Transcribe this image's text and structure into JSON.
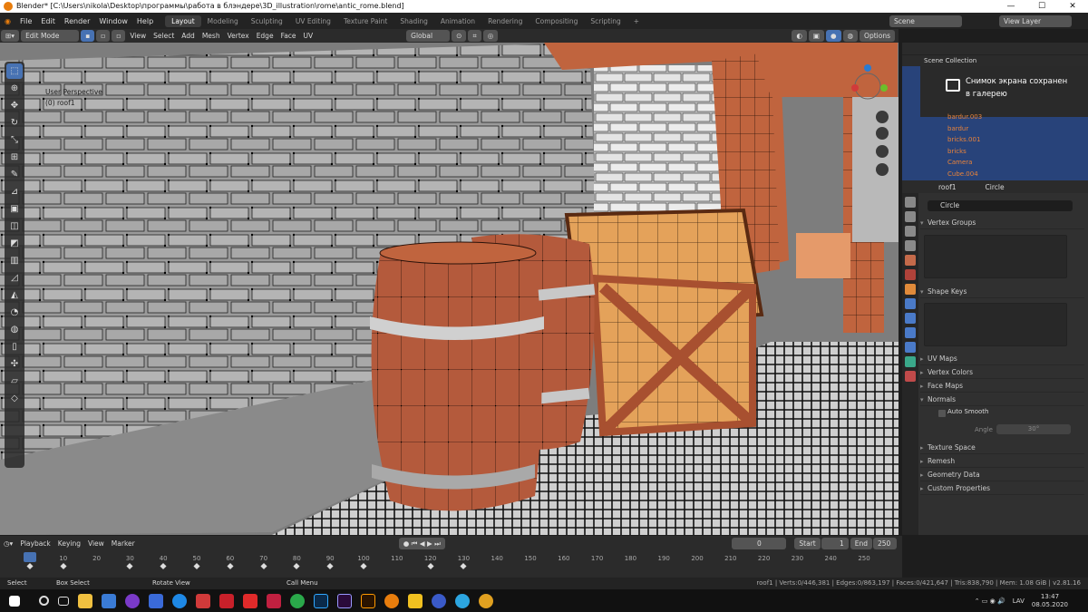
{
  "window": {
    "title": "Blender* [C:\\Users\\nikola\\Desktop\\программы\\работа в блэндере\\3D_illustration\\rome\\antic_rome.blend]",
    "min": "—",
    "max": "☐",
    "close": "✕"
  },
  "menu": [
    "File",
    "Edit",
    "Render",
    "Window",
    "Help"
  ],
  "workspaces": [
    "Layout",
    "Modeling",
    "Sculpting",
    "UV Editing",
    "Texture Paint",
    "Shading",
    "Animation",
    "Rendering",
    "Compositing",
    "Scripting"
  ],
  "scene": {
    "label": "Scene",
    "view_layer": "View Layer"
  },
  "viewport_header": {
    "mode": "Edit Mode",
    "menus": [
      "View",
      "Select",
      "Add",
      "Mesh",
      "Vertex",
      "Edge",
      "Face",
      "UV"
    ],
    "orientation": "Global",
    "options": "Options"
  },
  "viewport": {
    "view_name": "User Perspective",
    "object": "(0) roof1"
  },
  "outliner": {
    "collection": "Scene Collection",
    "items": [
      "bardur.003",
      "bardur",
      "bricks.001",
      "bricks",
      "Camera",
      "Cube.004"
    ]
  },
  "toast": {
    "line1": "Снимок экрана сохранен",
    "line2": "в галерею"
  },
  "properties": {
    "object": "roof1",
    "data": "Circle",
    "mesh_name": "Circle",
    "panels": {
      "vertex_groups": "Vertex Groups",
      "shape_keys": "Shape Keys",
      "uv_maps": "UV Maps",
      "vertex_colors": "Vertex Colors",
      "face_maps": "Face Maps",
      "normals": "Normals",
      "auto_smooth": "Auto Smooth",
      "angle_label": "Angle",
      "angle_value": "30°",
      "texture_space": "Texture Space",
      "remesh": "Remesh",
      "geometry_data": "Geometry Data",
      "custom_properties": "Custom Properties"
    }
  },
  "timeline": {
    "menus": [
      "Playback",
      "Keying",
      "View",
      "Marker"
    ],
    "current_frame": "0",
    "start_label": "Start",
    "start": "1",
    "end_label": "End",
    "end": "250",
    "ticks": [
      "0",
      "10",
      "20",
      "30",
      "40",
      "50",
      "60",
      "70",
      "80",
      "90",
      "100",
      "110",
      "120",
      "130",
      "140",
      "150",
      "160",
      "170",
      "180",
      "190",
      "200",
      "210",
      "220",
      "230",
      "240",
      "250"
    ],
    "keys": [
      0,
      10,
      30,
      40,
      50,
      60,
      70,
      80,
      90,
      100,
      120,
      130
    ]
  },
  "status": {
    "select": "Select",
    "box_select": "Box Select",
    "rotate": "Rotate View",
    "call_menu": "Call Menu",
    "stats": "roof1 | Verts:0/446,381 | Edges:0/863,197 | Faces:0/421,647 | Tris:838,790 | Mem: 1.08 GiB | v2.81.16"
  },
  "taskbar": {
    "lang": "LAV",
    "time": "13:47",
    "date": "08.05.2020"
  },
  "colors": {
    "accent": "#4772b3",
    "orange": "#e87d0d",
    "outliner_sel": "#28437a"
  }
}
